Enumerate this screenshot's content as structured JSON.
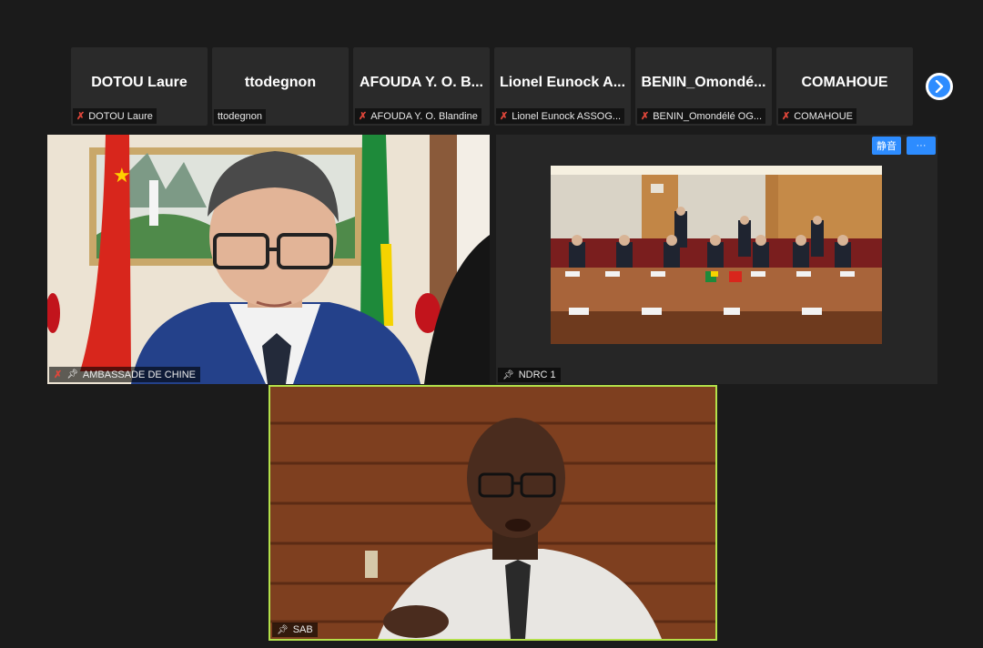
{
  "participants_strip": [
    {
      "display": "DOTOU Laure",
      "name_tag": "DOTOU Laure",
      "muted": true
    },
    {
      "display": "ttodegnon",
      "name_tag": "ttodegnon",
      "muted": false
    },
    {
      "display": "AFOUDA Y. O. B...",
      "name_tag": "AFOUDA Y. O. Blandine",
      "muted": true
    },
    {
      "display": "Lionel Eunock A...",
      "name_tag": "Lionel Eunock ASSOG...",
      "muted": true
    },
    {
      "display": "BENIN_Omondé...",
      "name_tag": "BENIN_Omondélé OG...",
      "muted": true
    },
    {
      "display": "COMAHOUE",
      "name_tag": "COMAHOUE",
      "muted": true
    }
  ],
  "next_page_icon": "chevron-right-icon",
  "videos": {
    "ambassade": {
      "name": "AMBASSADE DE CHINE",
      "muted": true,
      "pinned": true
    },
    "ndrc": {
      "name": "NDRC 1",
      "pinned": true,
      "buttons": {
        "mute_label": "静音",
        "more_label": "···"
      }
    },
    "sab": {
      "name": "SAB",
      "pinned": true,
      "active_speaker": true
    }
  },
  "colors": {
    "background": "#1b1b1b",
    "tile": "#2a2a2a",
    "accent_blue": "#2d8cff",
    "mute_red": "#e0463a",
    "active_speaker_border": "#b3e04a"
  }
}
